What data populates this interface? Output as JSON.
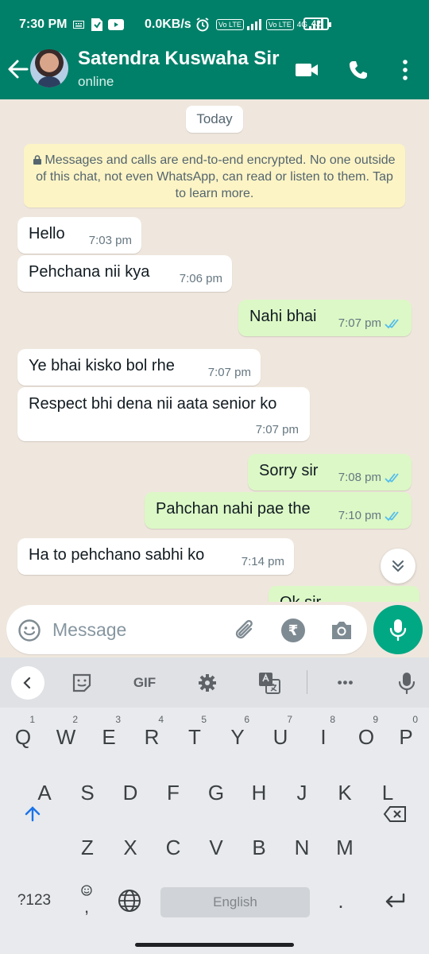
{
  "status_bar": {
    "time": "7:30 PM",
    "net_speed": "0.0KB/s",
    "volte1": "Vo LTE",
    "volte2": "Vo LTE",
    "network": "4G",
    "battery": "42"
  },
  "header": {
    "contact_name": "Satendra Kuswaha Sir",
    "contact_status": "online"
  },
  "chat": {
    "date_chip": "Today",
    "encryption_notice": "Messages and calls are end-to-end encrypted. No one outside of this chat, not even WhatsApp, can read or listen to them. Tap to learn more.",
    "messages": [
      {
        "dir": "in",
        "text": "Hello",
        "time": "7:03 pm"
      },
      {
        "dir": "in",
        "text": "Pehchana nii kya",
        "time": "7:06 pm"
      },
      {
        "dir": "out",
        "text": "Nahi bhai",
        "time": "7:07 pm"
      },
      {
        "dir": "in",
        "text": "Ye bhai kisko bol rhe",
        "time": "7:07 pm"
      },
      {
        "dir": "in",
        "text": "Respect bhi dena nii aata senior ko",
        "time": "7:07 pm"
      },
      {
        "dir": "out",
        "text": "Sorry sir",
        "time": "7:08 pm"
      },
      {
        "dir": "out",
        "text": "Pahchan nahi pae the",
        "time": "7:10 pm"
      },
      {
        "dir": "in",
        "text": "Ha to pehchano sabhi ko",
        "time": "7:14 pm"
      },
      {
        "dir": "out",
        "text": "Ok sir",
        "time": ""
      }
    ]
  },
  "composer": {
    "placeholder": "Message",
    "rupee_symbol": "₹"
  },
  "keyboard": {
    "toolbar_gif": "GIF",
    "toolbar_more": "•••",
    "row1": [
      {
        "k": "Q",
        "h": "1"
      },
      {
        "k": "W",
        "h": "2"
      },
      {
        "k": "E",
        "h": "3"
      },
      {
        "k": "R",
        "h": "4"
      },
      {
        "k": "T",
        "h": "5"
      },
      {
        "k": "Y",
        "h": "6"
      },
      {
        "k": "U",
        "h": "7"
      },
      {
        "k": "I",
        "h": "8"
      },
      {
        "k": "O",
        "h": "9"
      },
      {
        "k": "P",
        "h": "0"
      }
    ],
    "row2": [
      "A",
      "S",
      "D",
      "F",
      "G",
      "H",
      "J",
      "K",
      "L"
    ],
    "row3": [
      "Z",
      "X",
      "C",
      "V",
      "B",
      "N",
      "M"
    ],
    "symbols_key": "?123",
    "comma_key": ",",
    "period_key": ".",
    "space_label": "English"
  },
  "colors": {
    "header": "#008069",
    "outgoing_bubble": "#dcf8c6",
    "incoming_bubble": "#ffffff",
    "mic_button": "#00a884",
    "read_ticks": "#53bdeb"
  }
}
